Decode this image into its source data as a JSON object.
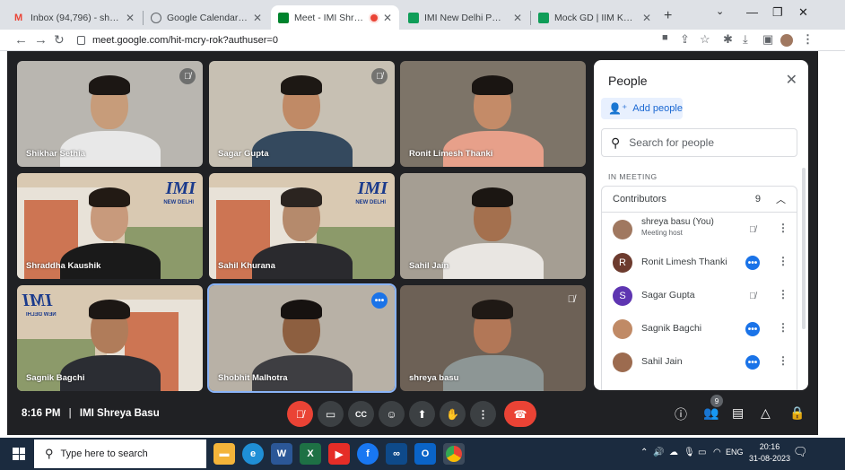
{
  "browser": {
    "tabs": [
      {
        "title": "Inbox (94,796) - shreyabasu3",
        "color": "#ea4335",
        "glyph": "M"
      },
      {
        "title": "Google Calendar - Friday, 1",
        "color": "#5f6368",
        "glyph": "⊕"
      },
      {
        "title": "Meet - IMI Shreya Basu",
        "color": "#00832d",
        "glyph": "▶",
        "active": true
      },
      {
        "title": "IMI New Delhi PGP - 1 Mock",
        "color": "#0f9d58",
        "glyph": "▦"
      },
      {
        "title": "Mock GD | IIM Kashipur - Go",
        "color": "#0f9d58",
        "glyph": "▦"
      }
    ],
    "url": "meet.google.com/hit-mcry-rok?authuser=0",
    "new_tab": "+"
  },
  "meeting": {
    "tiles": [
      {
        "name": "Shikhar Sethia",
        "bg": "#b9b6b0",
        "skin": "#c79c7a",
        "shirt": "#e8e8e8",
        "hair": "#1c1714",
        "muted": "circle",
        "imi": false
      },
      {
        "name": "Sagar Gupta",
        "bg": "#c7c0b3",
        "skin": "#c08a66",
        "shirt": "#34495e",
        "hair": "#1d1814",
        "muted": "circle",
        "imi": false
      },
      {
        "name": "Ronit Limesh Thanki",
        "bg": "#7d7468",
        "skin": "#c48b68",
        "shirt": "#e7a08a",
        "hair": "#1a1512",
        "muted": "",
        "imi": false
      },
      {
        "name": "Shraddha Kaushik",
        "bg": "#d9c9b2",
        "skin": "#c89a7c",
        "shirt": "#1a1a1a",
        "hair": "#221a14",
        "muted": "",
        "imi": true
      },
      {
        "name": "Sahil Khurana",
        "bg": "#d9c9b2",
        "skin": "#b58a6c",
        "shirt": "#2a2a2e",
        "hair": "#2b2420",
        "muted": "",
        "imi": true
      },
      {
        "name": "Sahil Jain",
        "bg": "#a59e93",
        "skin": "#a4704e",
        "shirt": "#e9e6e2",
        "hair": "#1b1612",
        "muted": "",
        "imi": false
      },
      {
        "name": "Sagnik Bagchi",
        "bg": "#d9c9b2",
        "skin": "#b07c5a",
        "shirt": "#2b2d33",
        "hair": "#1c1714",
        "muted": "",
        "imi": true,
        "mirrored": true
      },
      {
        "name": "Shobhit Malhotra",
        "bg": "#b8b1a6",
        "skin": "#8d5f40",
        "shirt": "#3e3e42",
        "hair": "#161210",
        "muted": "",
        "imi": false,
        "dots": true,
        "highlight": true
      },
      {
        "name": "shreya basu",
        "bg": "#6d6156",
        "skin": "#b27757",
        "shirt": "#8d9695",
        "hair": "#1f1915",
        "muted": "bare",
        "imi": false
      }
    ],
    "imi_logo": "IMI",
    "imi_sub": "NEW DELHI",
    "clock": "8:16 PM",
    "meeting_name": "IMI Shreya Basu",
    "people_badge": "9"
  },
  "people_panel": {
    "title": "People",
    "add_people": "Add people",
    "search_placeholder": "Search for people",
    "in_meeting": "IN MEETING",
    "contributors_label": "Contributors",
    "contributors_count": "9",
    "participants": [
      {
        "name": "shreya basu (You)",
        "sub": "Meeting host",
        "avatar": "photo",
        "avatar_color": "#a07860",
        "status": "muted"
      },
      {
        "name": "Ronit Limesh Thanki",
        "sub": "",
        "avatar": "R",
        "avatar_color": "#6d3b2e",
        "status": "active"
      },
      {
        "name": "Sagar Gupta",
        "sub": "",
        "avatar": "S",
        "avatar_color": "#5e35b1",
        "status": "muted"
      },
      {
        "name": "Sagnik Bagchi",
        "sub": "",
        "avatar": "photo",
        "avatar_color": "#c08a66",
        "status": "active"
      },
      {
        "name": "Sahil Jain",
        "sub": "",
        "avatar": "photo",
        "avatar_color": "#9c6b4f",
        "status": "active"
      }
    ]
  },
  "taskbar": {
    "search_placeholder": "Type here to search",
    "language": "ENG",
    "time": "20:16",
    "date": "31-08-2023"
  }
}
